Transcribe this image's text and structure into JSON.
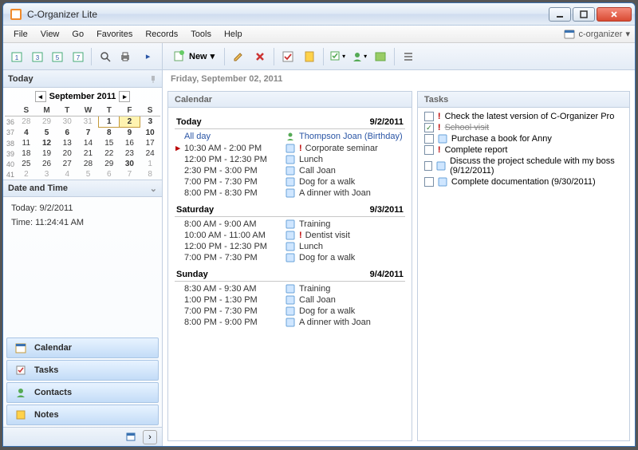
{
  "titlebar": {
    "title": "C-Organizer Lite"
  },
  "menubar": {
    "items": [
      "File",
      "View",
      "Go",
      "Favorites",
      "Records",
      "Tools",
      "Help"
    ],
    "branding": "c-organizer"
  },
  "left_toolbar": {
    "mode_labels": [
      "1",
      "3",
      "5",
      "7"
    ]
  },
  "right_toolbar": {
    "new_label": "New"
  },
  "sidebar": {
    "header": "Today",
    "month_label": "September 2011",
    "dow": [
      "S",
      "M",
      "T",
      "W",
      "T",
      "F",
      "S"
    ],
    "weeks": [
      {
        "wk": "36",
        "days": [
          {
            "d": "28",
            "dim": true
          },
          {
            "d": "29",
            "dim": true
          },
          {
            "d": "30",
            "dim": true
          },
          {
            "d": "31",
            "dim": true
          },
          {
            "d": "1",
            "sel": true,
            "bold": true
          },
          {
            "d": "2",
            "today": true,
            "bold": true
          },
          {
            "d": "3",
            "bold": true
          }
        ]
      },
      {
        "wk": "37",
        "days": [
          {
            "d": "4",
            "bold": true
          },
          {
            "d": "5",
            "bold": true
          },
          {
            "d": "6",
            "bold": true
          },
          {
            "d": "7",
            "bold": true
          },
          {
            "d": "8",
            "bold": true
          },
          {
            "d": "9",
            "bold": true
          },
          {
            "d": "10",
            "bold": true
          }
        ]
      },
      {
        "wk": "38",
        "days": [
          {
            "d": "11"
          },
          {
            "d": "12",
            "bold": true
          },
          {
            "d": "13"
          },
          {
            "d": "14"
          },
          {
            "d": "15"
          },
          {
            "d": "16"
          },
          {
            "d": "17"
          }
        ]
      },
      {
        "wk": "39",
        "days": [
          {
            "d": "18"
          },
          {
            "d": "19"
          },
          {
            "d": "20"
          },
          {
            "d": "21"
          },
          {
            "d": "22"
          },
          {
            "d": "23"
          },
          {
            "d": "24"
          }
        ]
      },
      {
        "wk": "40",
        "days": [
          {
            "d": "25"
          },
          {
            "d": "26"
          },
          {
            "d": "27"
          },
          {
            "d": "28"
          },
          {
            "d": "29"
          },
          {
            "d": "30",
            "bold": true
          },
          {
            "d": "1",
            "dim": true
          }
        ]
      },
      {
        "wk": "41",
        "days": [
          {
            "d": "2",
            "dim": true
          },
          {
            "d": "3",
            "dim": true
          },
          {
            "d": "4",
            "dim": true
          },
          {
            "d": "5",
            "dim": true
          },
          {
            "d": "6",
            "dim": true
          },
          {
            "d": "7",
            "dim": true
          },
          {
            "d": "8",
            "dim": true
          }
        ]
      }
    ],
    "dt_header": "Date and Time",
    "dt_today_label": "Today: 9/2/2011",
    "dt_time_label": "Time: 11:24:41 AM",
    "nav": [
      "Calendar",
      "Tasks",
      "Contacts",
      "Notes"
    ]
  },
  "main": {
    "date_header": "Friday, September 02, 2011",
    "calendar_header": "Calendar",
    "tasks_header": "Tasks",
    "days": [
      {
        "title": "Today",
        "date": "9/2/2011",
        "events": [
          {
            "time": "All day",
            "allday": true,
            "text": "Thompson Joan (Birthday)",
            "kind": "birthday"
          },
          {
            "time": "10:30 AM - 2:00 PM",
            "current": true,
            "warn": true,
            "text": "Corporate seminar"
          },
          {
            "time": "12:00 PM - 12:30 PM",
            "text": "Lunch"
          },
          {
            "time": "2:30 PM - 3:00 PM",
            "text": "Call Joan"
          },
          {
            "time": "7:00 PM - 7:30 PM",
            "text": "Dog for a walk"
          },
          {
            "time": "8:00 PM - 8:30 PM",
            "text": "A dinner with Joan"
          }
        ]
      },
      {
        "title": "Saturday",
        "date": "9/3/2011",
        "events": [
          {
            "time": "8:00 AM - 9:00 AM",
            "text": "Training"
          },
          {
            "time": "10:00 AM - 11:00 AM",
            "warn": true,
            "text": "Dentist visit"
          },
          {
            "time": "12:00 PM - 12:30 PM",
            "text": "Lunch"
          },
          {
            "time": "7:00 PM - 7:30 PM",
            "text": "Dog for a walk"
          }
        ]
      },
      {
        "title": "Sunday",
        "date": "9/4/2011",
        "events": [
          {
            "time": "8:30 AM - 9:30 AM",
            "text": "Training"
          },
          {
            "time": "1:00 PM - 1:30 PM",
            "text": "Call Joan"
          },
          {
            "time": "7:00 PM - 7:30 PM",
            "text": "Dog for a walk"
          },
          {
            "time": "8:00 PM - 9:00 PM",
            "text": "A dinner with Joan"
          }
        ]
      }
    ],
    "tasks": [
      {
        "done": false,
        "warn": true,
        "text": "Check the latest version of C-Organizer Pro"
      },
      {
        "done": true,
        "warn": true,
        "text": "School visit"
      },
      {
        "done": false,
        "text": "Purchase a book for Anny"
      },
      {
        "done": false,
        "warn": true,
        "text": "Complete report"
      },
      {
        "done": false,
        "text": "Discuss the project schedule with my boss (9/12/2011)"
      },
      {
        "done": false,
        "text": "Complete documentation (9/30/2011)"
      }
    ]
  }
}
